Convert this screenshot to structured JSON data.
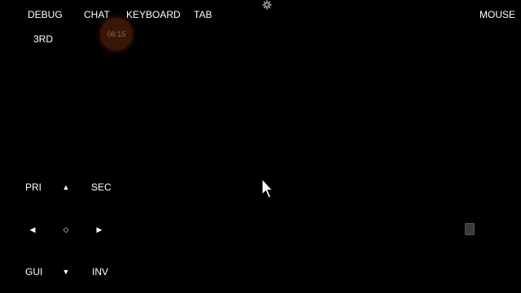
{
  "top_bar": {
    "debug_label": "DEBUG",
    "chat_label": "CHAT",
    "keyboard_label": "KEYBOARD",
    "tab_label": "TAB",
    "mouse_label": "MOUSE",
    "third_label": "3RD",
    "settings_icon": "gear-icon"
  },
  "timer": {
    "text": "06:15",
    "color": "#3a1606"
  },
  "controls": {
    "pri_label": "PRI",
    "sec_label": "SEC",
    "gui_label": "GUI",
    "inv_label": "INV",
    "up_glyph": "▲",
    "down_glyph": "▼",
    "left_glyph": "◀",
    "right_glyph": "▶",
    "center_glyph": "◇"
  },
  "pointer": {
    "icon": "mouse-cursor-icon"
  },
  "right_button": {
    "icon": "square-button-icon"
  }
}
